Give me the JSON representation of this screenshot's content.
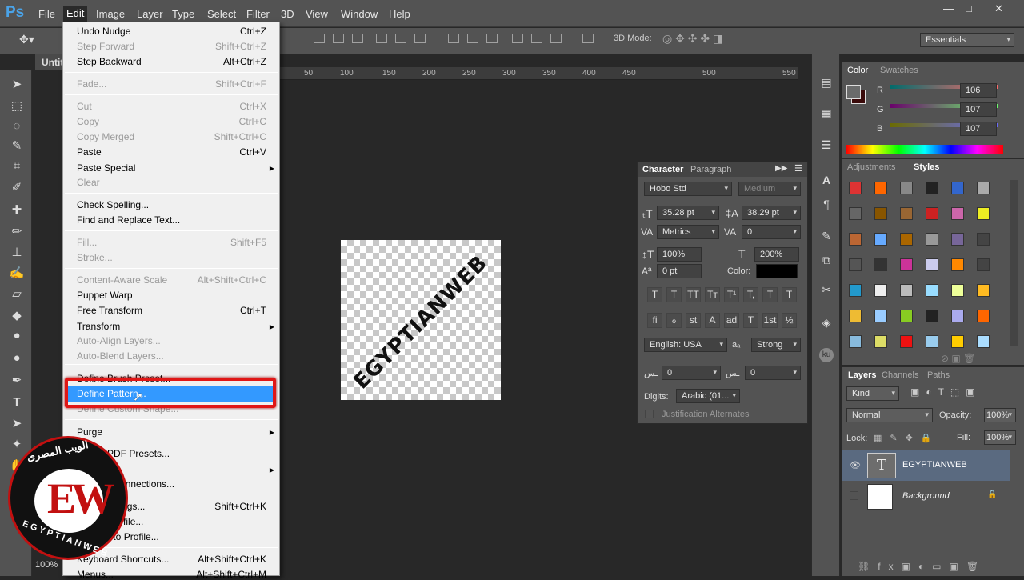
{
  "app": {
    "logo": "Ps"
  },
  "menubar": [
    "File",
    "Edit",
    "Image",
    "Layer",
    "Type",
    "Select",
    "Filter",
    "3D",
    "View",
    "Window",
    "Help"
  ],
  "window_controls": [
    "—",
    "□",
    "✕"
  ],
  "options_bar": {
    "label_3d": "3D Mode:",
    "workspace": "Essentials"
  },
  "document": {
    "tab_title": "Untit",
    "zoom": "100%"
  },
  "ruler_ticks": [
    "50",
    "100",
    "150",
    "200",
    "250",
    "300",
    "350",
    "400",
    "450",
    "500",
    "550"
  ],
  "canvas": {
    "text": "EGYPTIANWEB"
  },
  "edit_menu": {
    "items": [
      {
        "label": "Undo Nudge",
        "shortcut": "Ctrl+Z",
        "enabled": true
      },
      {
        "label": "Step Forward",
        "shortcut": "Shift+Ctrl+Z",
        "enabled": false
      },
      {
        "label": "Step Backward",
        "shortcut": "Alt+Ctrl+Z",
        "enabled": true
      },
      {
        "label": "Fade...",
        "shortcut": "Shift+Ctrl+F",
        "enabled": false
      },
      {
        "label": "Cut",
        "shortcut": "Ctrl+X",
        "enabled": false
      },
      {
        "label": "Copy",
        "shortcut": "Ctrl+C",
        "enabled": false
      },
      {
        "label": "Copy Merged",
        "shortcut": "Shift+Ctrl+C",
        "enabled": false
      },
      {
        "label": "Paste",
        "shortcut": "Ctrl+V",
        "enabled": true
      },
      {
        "label": "Paste Special",
        "shortcut": "",
        "enabled": true
      },
      {
        "label": "Clear",
        "shortcut": "",
        "enabled": false
      },
      {
        "label": "Check Spelling...",
        "shortcut": "",
        "enabled": true
      },
      {
        "label": "Find and Replace Text...",
        "shortcut": "",
        "enabled": true
      },
      {
        "label": "Fill...",
        "shortcut": "Shift+F5",
        "enabled": false
      },
      {
        "label": "Stroke...",
        "shortcut": "",
        "enabled": false
      },
      {
        "label": "Content-Aware Scale",
        "shortcut": "Alt+Shift+Ctrl+C",
        "enabled": false
      },
      {
        "label": "Puppet Warp",
        "shortcut": "",
        "enabled": true
      },
      {
        "label": "Free Transform",
        "shortcut": "Ctrl+T",
        "enabled": true
      },
      {
        "label": "Transform",
        "shortcut": "",
        "enabled": true
      },
      {
        "label": "Auto-Align Layers...",
        "shortcut": "",
        "enabled": false
      },
      {
        "label": "Auto-Blend Layers...",
        "shortcut": "",
        "enabled": false
      },
      {
        "label": "Define Brush Preset...",
        "shortcut": "",
        "enabled": true
      },
      {
        "label": "Define Pattern...",
        "shortcut": "",
        "enabled": true
      },
      {
        "label": "Define Custom Shape...",
        "shortcut": "",
        "enabled": false
      },
      {
        "label": "Purge",
        "shortcut": "",
        "enabled": true
      },
      {
        "label": "Adobe PDF Presets...",
        "shortcut": "",
        "enabled": true
      },
      {
        "label": "Presets",
        "shortcut": "",
        "enabled": true
      },
      {
        "label": "Remote Connections...",
        "shortcut": "",
        "enabled": true
      },
      {
        "label": "Color Settings...",
        "shortcut": "Shift+Ctrl+K",
        "enabled": true
      },
      {
        "label": "Assign Profile...",
        "shortcut": "",
        "enabled": true
      },
      {
        "label": "Convert to Profile...",
        "shortcut": "",
        "enabled": true
      },
      {
        "label": "Keyboard Shortcuts...",
        "shortcut": "Alt+Shift+Ctrl+K",
        "enabled": true
      },
      {
        "label": "Menus...",
        "shortcut": "Alt+Shift+Ctrl+M",
        "enabled": true
      }
    ],
    "highlighted": "Define Pattern..."
  },
  "color_panel": {
    "tabs": [
      "Color",
      "Swatches"
    ],
    "r_label": "R",
    "g_label": "G",
    "b_label": "B",
    "r": "106",
    "g": "107",
    "b": "107"
  },
  "styles_panel": {
    "tabs": [
      "Adjustments",
      "Styles"
    ]
  },
  "character_panel": {
    "tabs": [
      "Character",
      "Paragraph"
    ],
    "font_family": "Hobo Std",
    "font_style": "Medium",
    "size": "35.28 pt",
    "leading": "38.29 pt",
    "kerning": "Metrics",
    "tracking": "0",
    "vscale": "100%",
    "hscale": "200%",
    "baseline": "0 pt",
    "color_label": "Color:",
    "language": "English: USA",
    "antialias": "Strong",
    "arabic_a": "0",
    "arabic_b": "0",
    "digits_label": "Digits:",
    "digits": "Arabic (01...",
    "justification": "Justification Alternates",
    "type_buttons": [
      "T",
      "T",
      "TT",
      "Tт",
      "T¹",
      "T,",
      "T",
      "Ŧ"
    ],
    "ot_buttons": [
      "fi",
      "ℴ",
      "st",
      "A",
      "ad",
      "T",
      "1st",
      "½"
    ]
  },
  "layers_panel": {
    "tabs": [
      "Layers",
      "Channels",
      "Paths"
    ],
    "filter": "Kind",
    "blend": "Normal",
    "opacity_label": "Opacity:",
    "opacity": "100%",
    "lock_label": "Lock:",
    "fill_label": "Fill:",
    "fill": "100%",
    "layers": [
      {
        "name": "EGYPTIANWEB",
        "type": "text"
      },
      {
        "name": "Background",
        "type": "fill"
      }
    ]
  },
  "watermark": {
    "arabic": "الويب المصرى",
    "letters": "EW",
    "english": "EGYPTIANWEB"
  },
  "colors": {
    "highlight": "#3399ff",
    "annotation": "#e01616",
    "panel": "#535353"
  }
}
